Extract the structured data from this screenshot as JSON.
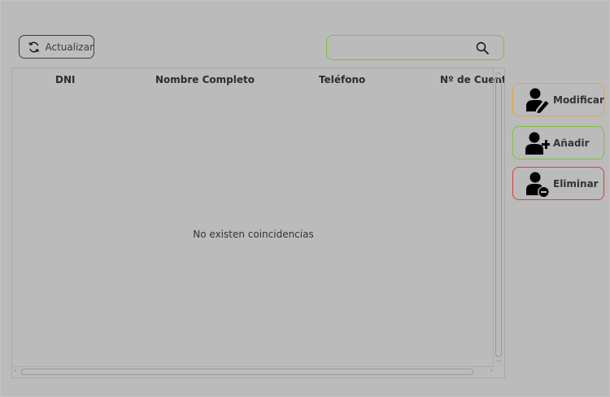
{
  "toolbar": {
    "refresh_label": "Actualizar",
    "search_value": ""
  },
  "table": {
    "columns": [
      "DNI",
      "Nombre Completo",
      "Teléfono",
      "Nº de Cuent"
    ],
    "empty_message": "No existen coincidencias"
  },
  "actions": {
    "modify_label": "Modificar",
    "add_label": "Añadir",
    "delete_label": "Eliminar"
  },
  "colors": {
    "background": "#bbbbbb",
    "modify_border": "#e6a82a",
    "add_border": "#7fbf3f",
    "delete_border": "#e23b3b",
    "search_border": "#7fbf3f"
  },
  "icons": {
    "refresh": "refresh-icon",
    "search": "search-icon",
    "modify": "user-edit-icon",
    "add": "user-add-icon",
    "delete": "user-remove-icon"
  }
}
